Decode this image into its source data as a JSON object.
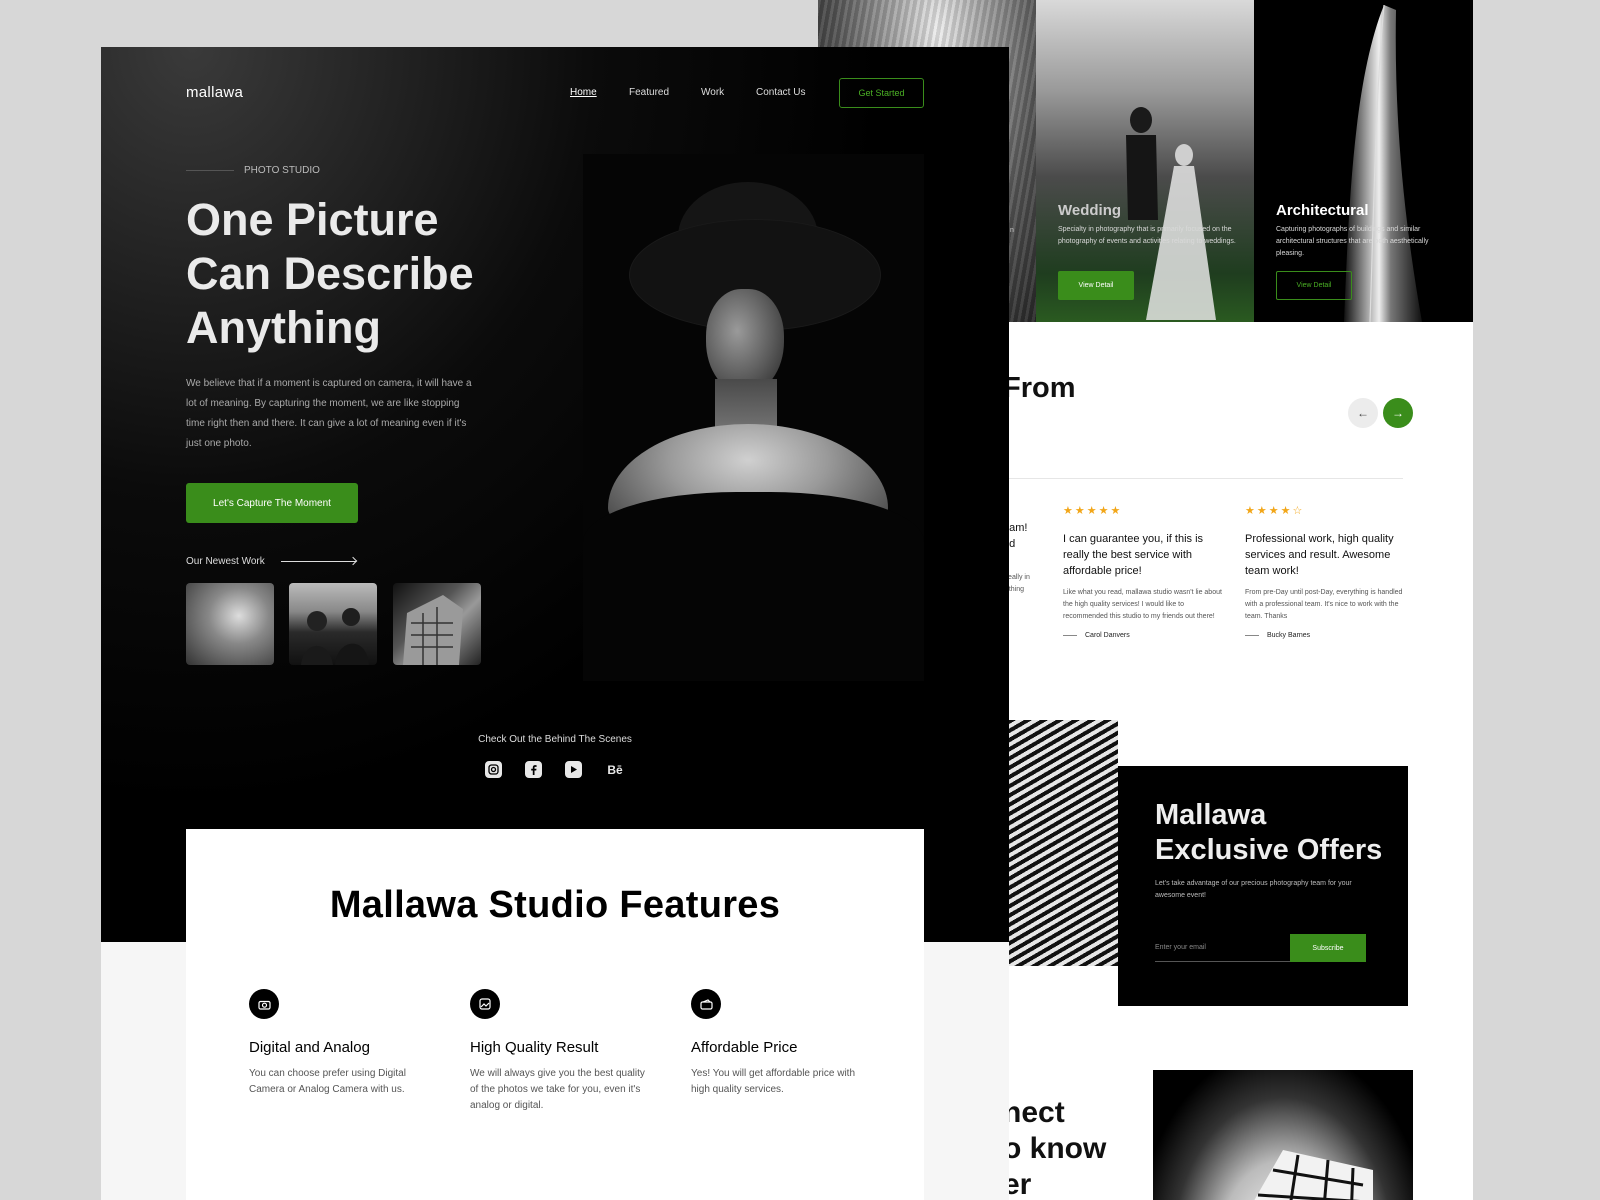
{
  "brand": "mallawa",
  "nav": {
    "items": [
      "Home",
      "Featured",
      "Work",
      "Contact Us"
    ],
    "cta": "Get Started"
  },
  "hero": {
    "eyebrow": "PHOTO STUDIO",
    "headline": "One Picture Can Describe Anything",
    "paragraph": "We believe that if a moment is captured on camera, it will have a lot of meaning. By capturing the moment, we are like stopping time right then and there. It can give a lot of meaning even if it's just one photo.",
    "button": "Let's Capture The Moment",
    "newest_label": "Our Newest Work"
  },
  "behind_scenes": {
    "label": "Check Out the Behind The Scenes",
    "icons": [
      "instagram-icon",
      "facebook-icon",
      "youtube-icon",
      "behance-icon"
    ],
    "behance_glyph": "Bē"
  },
  "features": {
    "title": "Mallawa Studio Features",
    "items": [
      {
        "icon": "camera-icon",
        "name": "Digital and Analog",
        "desc": "You can choose prefer using Digital Camera or Analog Camera with us."
      },
      {
        "icon": "image-icon",
        "name": "High Quality Result",
        "desc": "We will always give you the best quality of the photos we take for you, even it's analog or digital."
      },
      {
        "icon": "wallet-icon",
        "name": "Affordable Price",
        "desc": "Yes! You will get affordable price with high quality services."
      }
    ]
  },
  "categories": [
    {
      "title": "",
      "desc": "n"
    },
    {
      "title": "Wedding",
      "desc": "Specialty in photography that is primarily focused on the photography of events and activities relating to weddings.",
      "button": "View Detail"
    },
    {
      "title": "Architectural",
      "desc": "Capturing photographs of buildings and similar architectural structures that are both aesthetically pleasing.",
      "button": "View Detail"
    }
  ],
  "testimonials": {
    "title_fragment": "From",
    "prev": "←",
    "next": "→",
    "partial": {
      "quote": "eam!\ned",
      "body": "Really in\nrything"
    },
    "items": [
      {
        "stars": "★★★★★",
        "rating": 5,
        "quote": "I can guarantee you, if this is really the best service with affordable price!",
        "body": "Like what you read, mallawa studio wasn't lie about the high quality services! I would like to recommended this studio to my friends out there!",
        "author": "Carol Danvers"
      },
      {
        "stars": "★★★★☆",
        "rating": 4,
        "quote": "Professional work, high quality services and result. Awesome team work!",
        "body": "From pre-Day until post-Day, everything is handled with a professional team. It's nice to work with the team. Thanks",
        "author": "Bucky Barnes"
      }
    ]
  },
  "offers": {
    "title": "Mallawa Exclusive Offers",
    "subtitle": "Let's take advantage of our precious photography team for your awesome event!",
    "email_placeholder": "Enter your email",
    "button": "Subscribe"
  },
  "connect_fragment": "nect\no know\ner",
  "colors": {
    "accent": "#3a8d1b",
    "star": "#f2a618"
  }
}
